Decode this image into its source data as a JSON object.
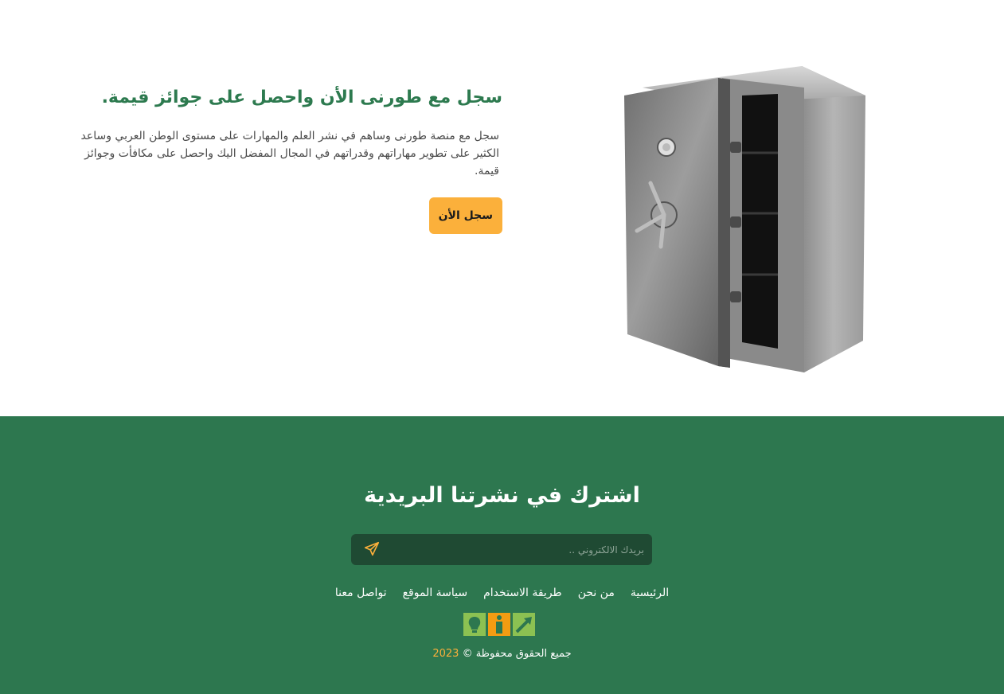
{
  "hero": {
    "title": "سجل مع طورنى الأن واحصل على جوائز قيمة.",
    "description": "سجل مع منصة طورنى وساهم في نشر العلم والمهارات على مستوى الوطن العربي وساعد الكثير على تطوير مهاراتهم وقدراتهم في المجال المفضل اليك واحصل على مكافأت وجوائز قيمة.",
    "cta_label": "سجل الأن",
    "image": "safe-illustration"
  },
  "footer": {
    "title": "اشترك في نشرتنا البريدية",
    "email_placeholder": "بريدك الالكتروني ..",
    "send_icon": "paper-plane-icon",
    "nav": [
      {
        "label": "الرئيسية"
      },
      {
        "label": "من نحن"
      },
      {
        "label": "طريقة الاستخدام"
      },
      {
        "label": "سياسة الموقع"
      },
      {
        "label": "تواصل معنا"
      }
    ],
    "copyright_text": "جميع الحقوق محفوظة ©",
    "copyright_year": "2023"
  },
  "colors": {
    "brand_green": "#2d774f",
    "accent_orange": "#fbb03b",
    "title_green": "#2d7a4f",
    "input_bg": "#1f4a33"
  }
}
